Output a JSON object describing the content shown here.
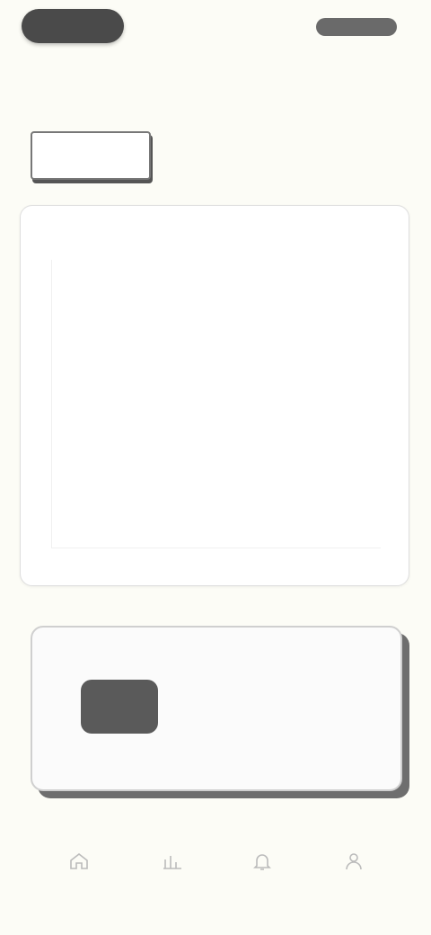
{
  "topbar": {
    "pill_label": "",
    "right_label": ""
  },
  "subtitle": "",
  "tabs": [
    {
      "label": ""
    },
    {
      "label": ""
    },
    {
      "label": ""
    }
  ],
  "card_main": {
    "header_title": "",
    "header_mid": "",
    "header_right": "",
    "center_value": "",
    "axis_note": ""
  },
  "card_2": {
    "title": "",
    "badge": "",
    "mini": "",
    "line1": "",
    "line2": ""
  },
  "nav": [
    {
      "label": "",
      "icon": "home-icon"
    },
    {
      "label": "",
      "icon": "chart-icon"
    },
    {
      "label": "",
      "icon": "bell-icon"
    },
    {
      "label": "",
      "icon": "user-icon"
    }
  ]
}
